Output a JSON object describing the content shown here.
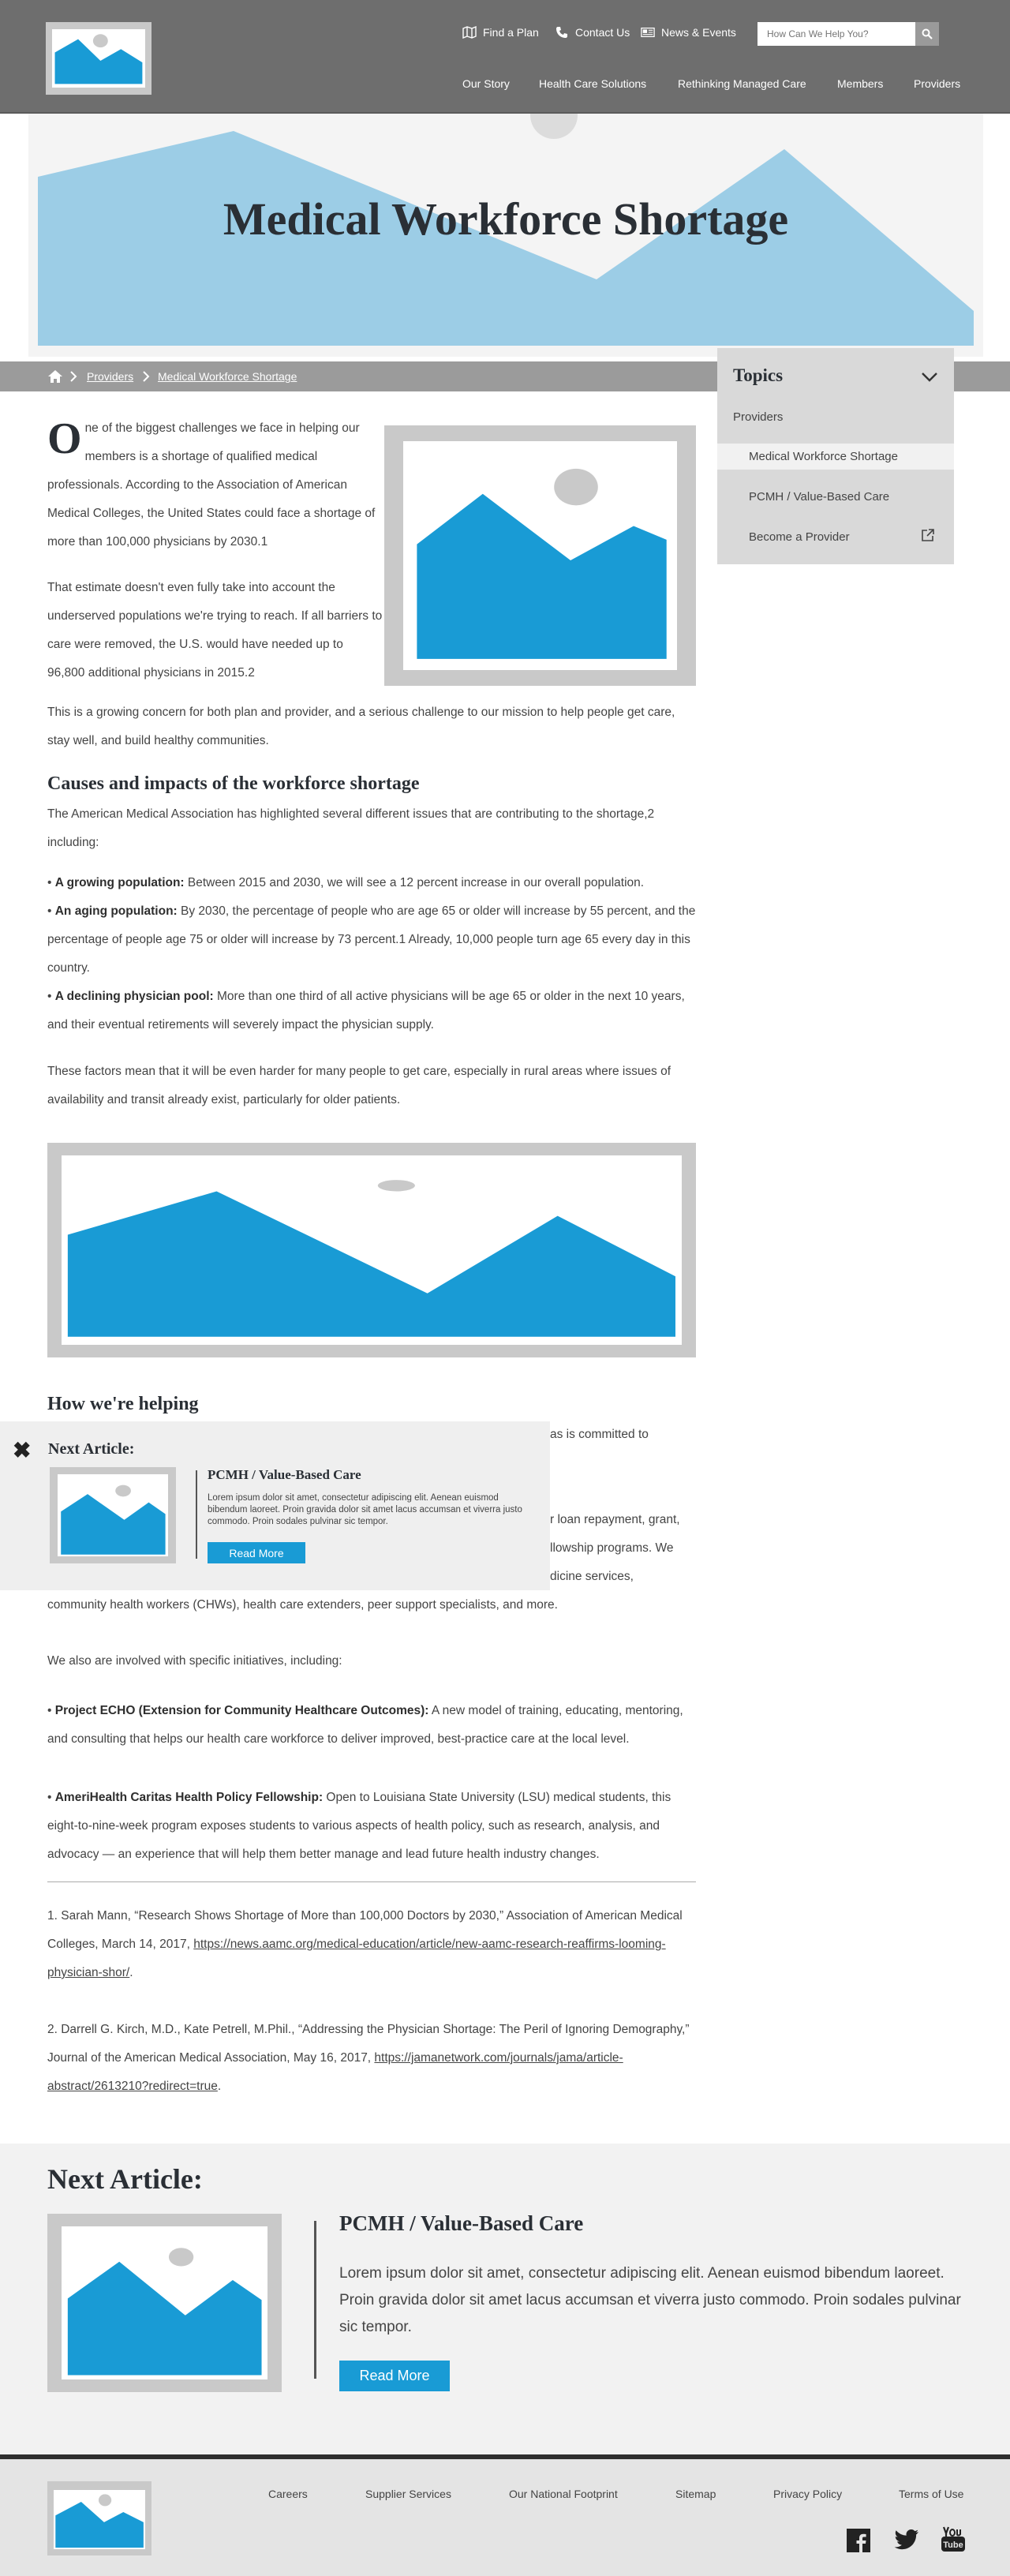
{
  "header": {
    "util": {
      "find_plan": "Find a Plan",
      "contact": "Contact Us",
      "news": "News & Events",
      "search_placeholder": "How Can We Help You?"
    },
    "nav": [
      "Our Story",
      "Health Care Solutions",
      "Rethinking Managed Care",
      "Members",
      "Providers"
    ]
  },
  "hero": {
    "title": "Medical Workforce Shortage"
  },
  "breadcrumb": {
    "providers": "Providers",
    "current": "Medical Workforce Shortage"
  },
  "topics": {
    "title": "Topics",
    "section": "Providers",
    "items": [
      "Medical Workforce Shortage",
      "PCMH / Value-Based Care",
      "Become a Provider"
    ]
  },
  "article": {
    "dropcap": "O",
    "intro_1": "ne of the biggest challenges we face in helping our members is a shortage of qualified medical professionals. According to the Association of American Medical Colleges, the United States could face a shortage of more than 100,000 physicians by 2030.1",
    "intro_2": "That estimate doesn't even fully take into account the underserved populations we're trying to reach. If all barriers to care were removed, the U.S. would have needed up to 96,800 additional physicians in 2015.2",
    "intro_3": "This is a growing concern for both plan and provider, and a serious challenge to our mission to help people get care, stay well, and build healthy communities.",
    "h_causes": "Causes and impacts of the workforce shortage",
    "causes_intro": "The American Medical Association has highlighted several different issues that are contributing to the shortage,2 including:",
    "bullets": [
      {
        "label": "A growing population:",
        "text": " Between 2015 and 2030, we will see a 12 percent increase in our overall population."
      },
      {
        "label": "An aging population:",
        "text": " By 2030, the percentage of people who are age 65 or older will increase by 55 percent, and the percentage of people age 75 or older will increase by 73 percent.1 Already, 10,000 people turn age 65 every day in this country."
      },
      {
        "label": "A declining physician pool:",
        "text": " More than one third of all active physicians will be age 65 or older in the next 10 years, and their eventual retirements will severely impact the physician supply."
      }
    ],
    "causes_outro": "These factors mean that it will be even harder for many people to get care, especially in rural areas where issues of availability and transit already exist, particularly for older patients.",
    "h_helping": "How we're helping",
    "help_frag_1": "as is committed to",
    "help_frag_2": "r loan repayment, grant,",
    "help_frag_3": "llowship programs. We",
    "help_frag_4": "dicine services,",
    "help_line_5": "community health workers (CHWs), health care extenders, peer support specialists, and more.",
    "initiatives_intro": "We also are involved with specific initiatives, including:",
    "initiatives": [
      {
        "label": "Project ECHO (Extension for Community Healthcare Outcomes):",
        "text": " A new model of training, educating, mentoring, and consulting that helps our health care workforce to deliver improved, best-practice care at the local level."
      },
      {
        "label": "AmeriHealth Caritas Health Policy Fellowship:",
        "text": " Open to Louisiana State University (LSU) medical students, this eight-to-nine-week program exposes students to various aspects of health policy, such as research, analysis, and advocacy — an experience that will help them better manage and lead future health industry changes."
      }
    ],
    "footnote_1_text": "1. Sarah Mann, “Research Shows Shortage of More than 100,000 Doctors by 2030,” Association of American Medical Colleges, March 14, 2017, ",
    "footnote_1_link": "https://news.aamc.org/medical-education/article/new-aamc-research-reaffirms-looming-physician-shor/",
    "footnote_2_text": "2. Darrell G. Kirch, M.D., Kate Petrell, M.Phil., “Addressing the Physician Shortage: The Peril of Ignoring Demography,” Journal of the American Medical Association, May 16, 2017, ",
    "footnote_2_link": "https://jamanetwork.com/journals/jama/article-abstract/2613210?redirect=true"
  },
  "popup": {
    "label": "Next Article:",
    "title": "PCMH / Value-Based Care",
    "desc": "Lorem ipsum dolor sit amet, consectetur adipiscing elit. Aenean euismod bibendum laoreet. Proin gravida dolor sit amet lacus accumsan et viverra justo commodo. Proin sodales pulvinar sic tempor.",
    "button": "Read More"
  },
  "next": {
    "label": "Next Article:",
    "title": "PCMH / Value-Based Care",
    "desc": "Lorem ipsum dolor sit amet, consectetur adipiscing elit. Aenean euismod bibendum laoreet. Proin gravida dolor sit amet lacus accumsan et viverra justo commodo. Proin sodales pulvinar sic tempor.",
    "button": "Read More"
  },
  "footer": {
    "links": [
      "Careers",
      "Supplier Services",
      "Our National Footprint",
      "Sitemap",
      "Privacy Policy",
      "Terms of Use"
    ]
  },
  "colors": {
    "accent": "#199bd5",
    "hero_blue": "#9ccde6",
    "header_gray": "#6e6e6e"
  }
}
